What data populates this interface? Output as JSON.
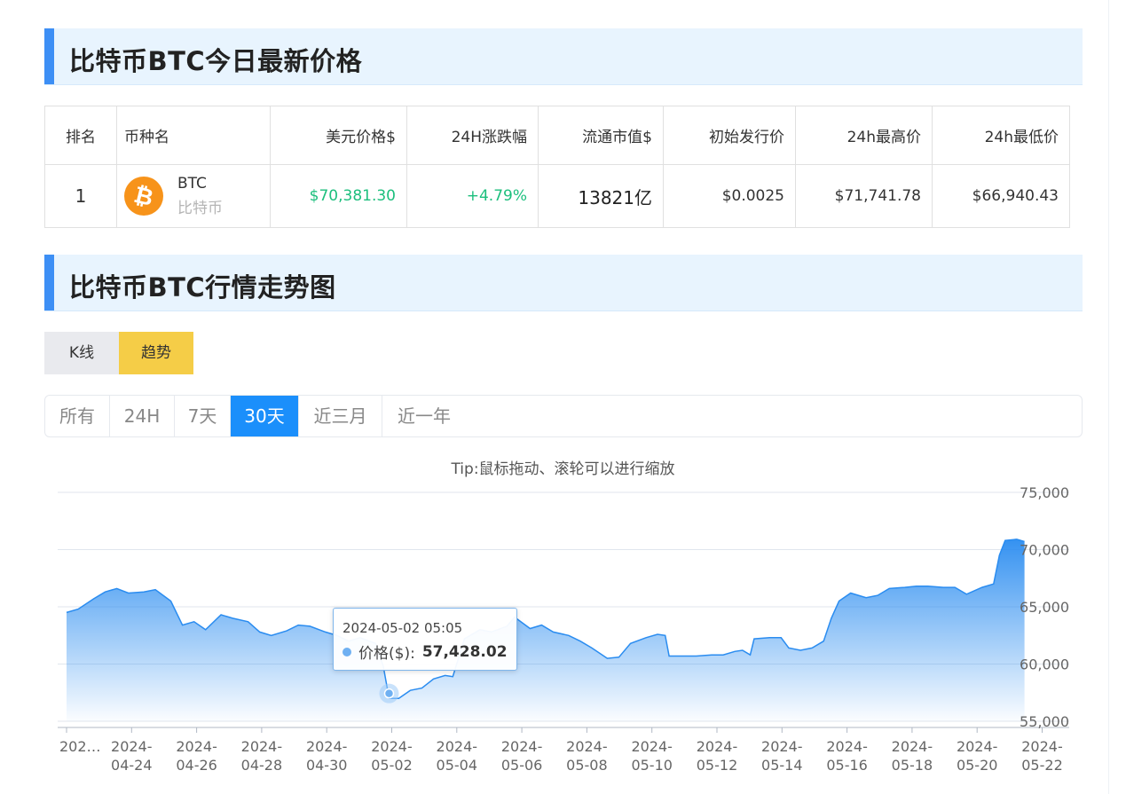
{
  "sections": {
    "price_title": "比特币BTC今日最新价格",
    "chart_title": "比特币BTC行情走势图"
  },
  "table": {
    "headers": [
      "排名",
      "币种名",
      "美元价格$",
      "24H涨跌幅",
      "流通市值$",
      "初始发行价",
      "24h最高价",
      "24h最低价"
    ],
    "row": {
      "rank": "1",
      "coin_icon": "bitcoin-icon",
      "symbol": "BTC",
      "name_cn": "比特币",
      "price": "$70,381.30",
      "change": "+4.79%",
      "market_cap": "13821亿",
      "initial_price": "$0.0025",
      "high_24h": "$71,741.78",
      "low_24h": "$66,940.43"
    }
  },
  "chart_type_tabs": [
    {
      "label": "K线",
      "active": false
    },
    {
      "label": "趋势",
      "active": true
    }
  ],
  "range_tabs": [
    {
      "label": "所有",
      "active": false
    },
    {
      "label": "24H",
      "active": false
    },
    {
      "label": "7天",
      "active": false
    },
    {
      "label": "30天",
      "active": true
    },
    {
      "label": "近三月",
      "active": false
    },
    {
      "label": "近一年",
      "active": false
    }
  ],
  "tip": "Tip:鼠标拖动、滚轮可以进行缩放",
  "tooltip": {
    "time": "2024-05-02 05:05",
    "label": "价格($):",
    "value": "57,428.02"
  },
  "colors": {
    "accent_blue": "#1b8ffb",
    "section_bar": "#3d8ff5",
    "active_yellow": "#f5cd47",
    "up_green": "#1cbf7d",
    "line_blue": "#2a8cf0",
    "btc_orange": "#f7931a"
  },
  "chart_data": {
    "type": "area",
    "title": "",
    "xlabel": "",
    "ylabel": "",
    "ylim": [
      55000,
      75000
    ],
    "y_ticks": [
      "55,000",
      "60,000",
      "65,000",
      "70,000",
      "75,000"
    ],
    "x_ticks": [
      "202…",
      "2024-04-24",
      "2024-04-26",
      "2024-04-28",
      "2024-04-30",
      "2024-05-02",
      "2024-05-04",
      "2024-05-06",
      "2024-05-08",
      "2024-05-10",
      "2024-05-12",
      "2024-05-14",
      "2024-05-16",
      "2024-05-18",
      "2024-05-20",
      "2024-05-22"
    ],
    "grid": true,
    "series": [
      {
        "values": [
          [
            0.0,
            64500
          ],
          [
            0.3,
            64800
          ],
          [
            0.7,
            65700
          ],
          [
            1.0,
            66300
          ],
          [
            1.3,
            66600
          ],
          [
            1.6,
            66200
          ],
          [
            2.0,
            66300
          ],
          [
            2.3,
            66500
          ],
          [
            2.7,
            65500
          ],
          [
            3.0,
            63400
          ],
          [
            3.3,
            63700
          ],
          [
            3.6,
            63000
          ],
          [
            4.0,
            64300
          ],
          [
            4.3,
            64000
          ],
          [
            4.7,
            63700
          ],
          [
            5.0,
            62800
          ],
          [
            5.3,
            62500
          ],
          [
            5.7,
            62900
          ],
          [
            6.0,
            63400
          ],
          [
            6.3,
            63300
          ],
          [
            6.7,
            62800
          ],
          [
            7.0,
            62500
          ],
          [
            7.3,
            62000
          ],
          [
            7.6,
            62300
          ],
          [
            8.0,
            61800
          ],
          [
            8.2,
            59800
          ],
          [
            8.35,
            57000
          ],
          [
            8.6,
            57000
          ],
          [
            8.9,
            57700
          ],
          [
            9.2,
            57900
          ],
          [
            9.5,
            58700
          ],
          [
            9.8,
            59000
          ],
          [
            10.0,
            58900
          ],
          [
            10.3,
            62200
          ],
          [
            10.7,
            63000
          ],
          [
            11.0,
            62800
          ],
          [
            11.4,
            63300
          ],
          [
            11.6,
            64100
          ],
          [
            12.0,
            63100
          ],
          [
            12.3,
            63400
          ],
          [
            12.6,
            62800
          ],
          [
            13.0,
            62500
          ],
          [
            13.3,
            62000
          ],
          [
            13.6,
            61400
          ],
          [
            14.0,
            60500
          ],
          [
            14.3,
            60600
          ],
          [
            14.6,
            61800
          ],
          [
            15.0,
            62300
          ],
          [
            15.3,
            62600
          ],
          [
            15.5,
            62500
          ],
          [
            15.6,
            60700
          ],
          [
            16.0,
            60700
          ],
          [
            16.3,
            60700
          ],
          [
            16.7,
            60800
          ],
          [
            17.0,
            60800
          ],
          [
            17.3,
            61100
          ],
          [
            17.5,
            61200
          ],
          [
            17.7,
            60800
          ],
          [
            17.8,
            62200
          ],
          [
            18.2,
            62300
          ],
          [
            18.5,
            62300
          ],
          [
            18.7,
            61400
          ],
          [
            19.0,
            61200
          ],
          [
            19.3,
            61400
          ],
          [
            19.6,
            62000
          ],
          [
            19.8,
            64000
          ],
          [
            20.0,
            65500
          ],
          [
            20.3,
            66200
          ],
          [
            20.7,
            65800
          ],
          [
            21.0,
            66000
          ],
          [
            21.3,
            66600
          ],
          [
            21.7,
            66700
          ],
          [
            22.0,
            66800
          ],
          [
            22.3,
            66800
          ],
          [
            22.7,
            66700
          ],
          [
            23.0,
            66700
          ],
          [
            23.3,
            66100
          ],
          [
            23.7,
            66700
          ],
          [
            24.0,
            67000
          ],
          [
            24.15,
            69500
          ],
          [
            24.3,
            70800
          ],
          [
            24.6,
            70900
          ],
          [
            24.8,
            70700
          ]
        ]
      }
    ]
  }
}
